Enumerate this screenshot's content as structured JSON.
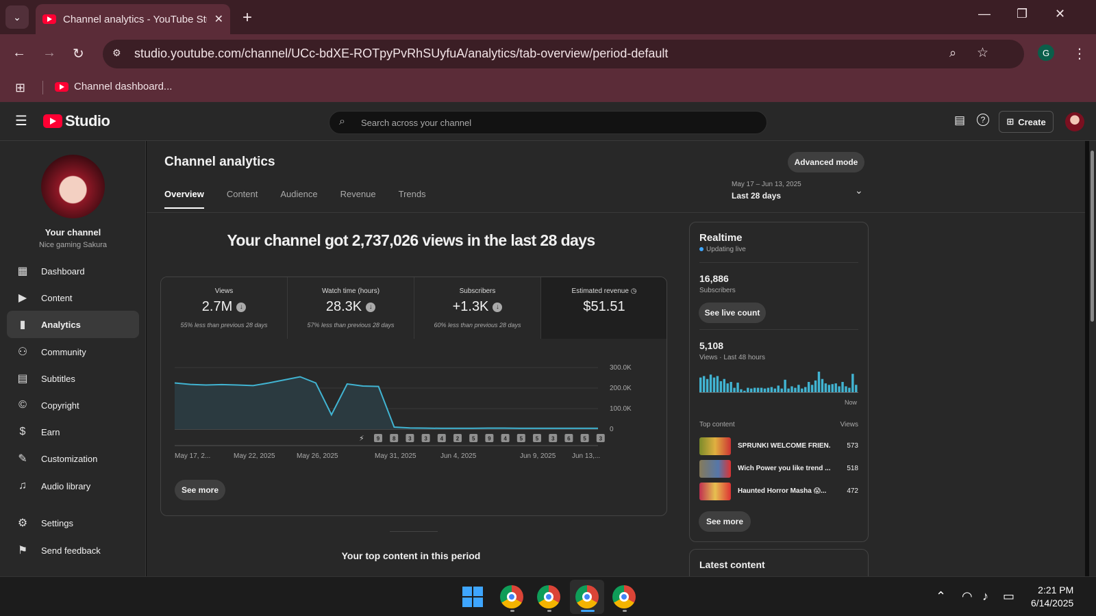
{
  "browser": {
    "tab_title": "Channel analytics - YouTube Studio",
    "url": "studio.youtube.com/channel/UCc-bdXE-ROTpyPvRhSUyfuA/analytics/tab-overview/period-default",
    "bookmark": "Channel dashboard...",
    "profile_initial": "G"
  },
  "header": {
    "logo_text": "Studio",
    "search_placeholder": "Search across your channel",
    "create_label": "Create"
  },
  "sidebar": {
    "channel_label": "Your channel",
    "channel_name": "Nice gaming Sakura",
    "items": [
      {
        "label": "Dashboard",
        "icon": "dashboard-icon",
        "glyph": "▦"
      },
      {
        "label": "Content",
        "icon": "content-icon",
        "glyph": "▶"
      },
      {
        "label": "Analytics",
        "icon": "analytics-icon",
        "glyph": "▮",
        "active": true
      },
      {
        "label": "Community",
        "icon": "community-icon",
        "glyph": "⚇"
      },
      {
        "label": "Subtitles",
        "icon": "subtitles-icon",
        "glyph": "▤"
      },
      {
        "label": "Copyright",
        "icon": "copyright-icon",
        "glyph": "©"
      },
      {
        "label": "Earn",
        "icon": "earn-icon",
        "glyph": "$"
      },
      {
        "label": "Customization",
        "icon": "customization-icon",
        "glyph": "✎"
      },
      {
        "label": "Audio library",
        "icon": "audio-library-icon",
        "glyph": "♫"
      },
      {
        "label": "Settings",
        "icon": "settings-icon",
        "glyph": "⚙"
      },
      {
        "label": "Send feedback",
        "icon": "feedback-icon",
        "glyph": "⚑"
      }
    ]
  },
  "main": {
    "title": "Channel analytics",
    "advanced_mode": "Advanced mode",
    "tabs": [
      "Overview",
      "Content",
      "Audience",
      "Revenue",
      "Trends"
    ],
    "period_range": "May 17 – Jun 13, 2025",
    "period_name": "Last 28 days",
    "headline": "Your channel got 2,737,026 views in the last 28 days",
    "metrics": [
      {
        "label": "Views",
        "value": "2.7M",
        "compare": "55% less than previous 28 days",
        "down": true
      },
      {
        "label": "Watch time (hours)",
        "value": "28.3K",
        "compare": "57% less than previous 28 days",
        "down": true
      },
      {
        "label": "Subscribers",
        "value": "+1.3K",
        "compare": "60% less than previous 28 days",
        "down": true
      },
      {
        "label": "Estimated revenue",
        "value": "$51.51",
        "compare": "",
        "down": false
      }
    ],
    "see_more": "See more",
    "top_content_heading": "Your top content in this period"
  },
  "chart_data": {
    "type": "area",
    "x_tick_labels": [
      "May 17, 2...",
      "May 22, 2025",
      "May 26, 2025",
      "May 31, 2025",
      "Jun 4, 2025",
      "Jun 9, 2025",
      "Jun 13,..."
    ],
    "y_tick_labels": [
      "300.0K",
      "200.0K",
      "100.0K",
      "0"
    ],
    "ylim": [
      0,
      300000
    ],
    "values": [
      225000,
      218000,
      215000,
      217000,
      215000,
      212000,
      225000,
      240000,
      255000,
      225000,
      70000,
      220000,
      210000,
      208000,
      10000,
      6000,
      5000,
      4000,
      4000,
      4000,
      5000,
      5000,
      4000,
      4000,
      4000,
      4000,
      4000,
      4000
    ],
    "upload_markers": [
      "9",
      "8",
      "3",
      "3",
      "4",
      "2",
      "5",
      "9",
      "4",
      "5",
      "5",
      "3",
      "6",
      "5",
      "3"
    ],
    "series": [
      {
        "color": "#41b4d2"
      }
    ],
    "grid": true
  },
  "realtime": {
    "title": "Realtime",
    "status": "Updating live",
    "subscribers": "16,886",
    "subscribers_label": "Subscribers",
    "see_live_count": "See live count",
    "views": "5,108",
    "views_label": "Views · Last 48 hours",
    "now_label": "Now",
    "bars": [
      20,
      22,
      18,
      24,
      20,
      22,
      15,
      18,
      12,
      14,
      6,
      13,
      4,
      2,
      6,
      5,
      6,
      6,
      6,
      5,
      6,
      7,
      5,
      9,
      5,
      17,
      5,
      8,
      6,
      10,
      5,
      7,
      14,
      10,
      16,
      28,
      18,
      12,
      10,
      11,
      12,
      8,
      14,
      8,
      6,
      25,
      10
    ],
    "top_content_label": "Top content",
    "views_col": "Views",
    "top_content": [
      {
        "title": "SPRUNKI WELCOME FRIEN...",
        "views": "573"
      },
      {
        "title": "Wich Power you like trend ...",
        "views": "518"
      },
      {
        "title": "Haunted Horror Masha 😱...",
        "views": "472"
      }
    ],
    "see_more": "See more"
  },
  "latest_content": "Latest content",
  "taskbar": {
    "time": "2:21 PM",
    "date": "6/14/2025"
  }
}
